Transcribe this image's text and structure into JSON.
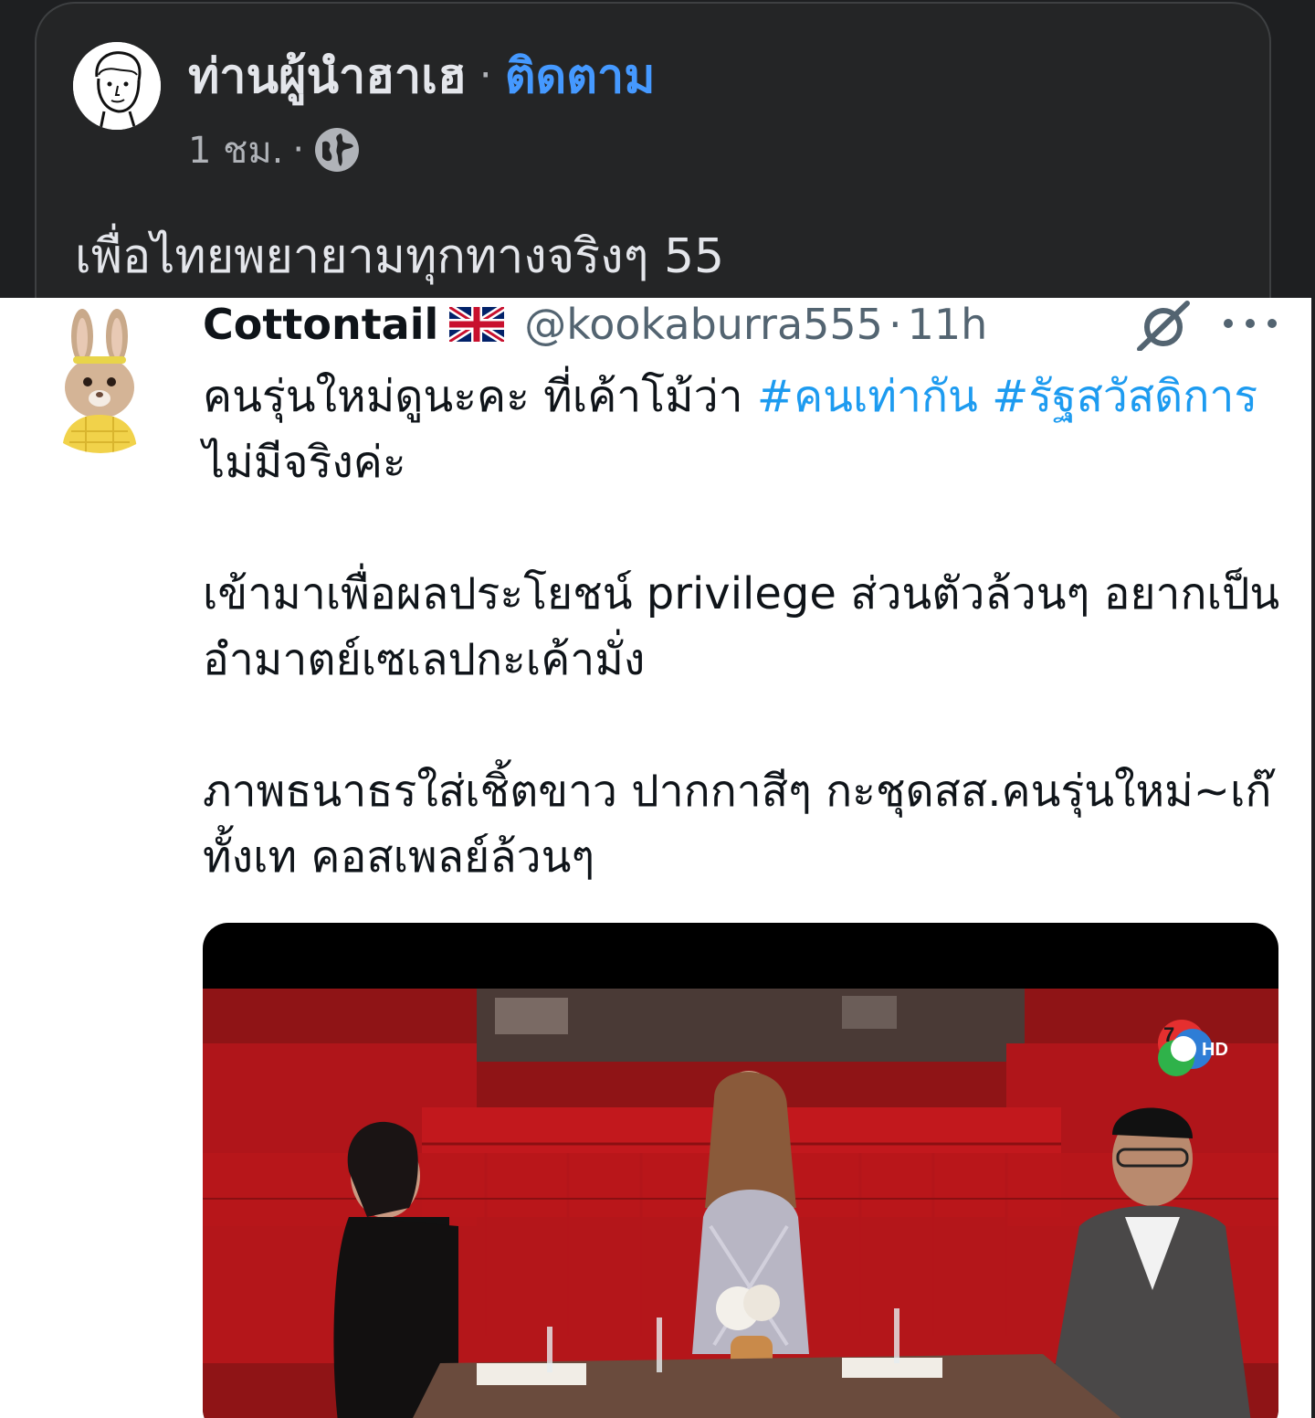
{
  "post": {
    "author": "ท่านผู้นำฮาเฮ",
    "separator": "·",
    "follow_label": "ติดตาม",
    "time": "1 ชม.",
    "privacy_icon": "globe-icon",
    "caption": "เพื่อไทยพยายามทุกทางจริงๆ 55"
  },
  "tweet": {
    "name": "Cottontail",
    "flag_icon": "uk-flag-icon",
    "handle": "@kookaburra555",
    "dot": "·",
    "time": "11h",
    "body": {
      "p1_text": "คนรุ่นใหม่ดูนะคะ ที่เค้าโม้ว่า ",
      "p1_hashtag1": "#คนเท่ากัน",
      "p1_space": " ",
      "p1_hashtag2": "#รัฐสวัสดิการ",
      "p1_tail": " ไม่มีจริงค่ะ",
      "p2": "เข้ามาเพื่อผลประโยชน์ privilege ส่วนตัวล้วนๆ อยากเป็นอำมาตย์เซเลปกะเค้ามั่ง",
      "p3": "ภาพธนาธรใส่เชิ้ตขาว ปากกาสีๆ กะชุดสส.คนรุ่นใหม่~เก๊ทั้งเท คอสเพลย์ล้วนๆ"
    },
    "media": {
      "channel_badge": "7",
      "channel_suffix": "HD"
    }
  },
  "colors": {
    "fb_bg": "#242526",
    "fb_text": "#e4e6eb",
    "fb_link": "#4599ff",
    "tw_text": "#0f1419",
    "tw_secondary": "#536471",
    "tw_hashtag": "#1d9bf0"
  }
}
